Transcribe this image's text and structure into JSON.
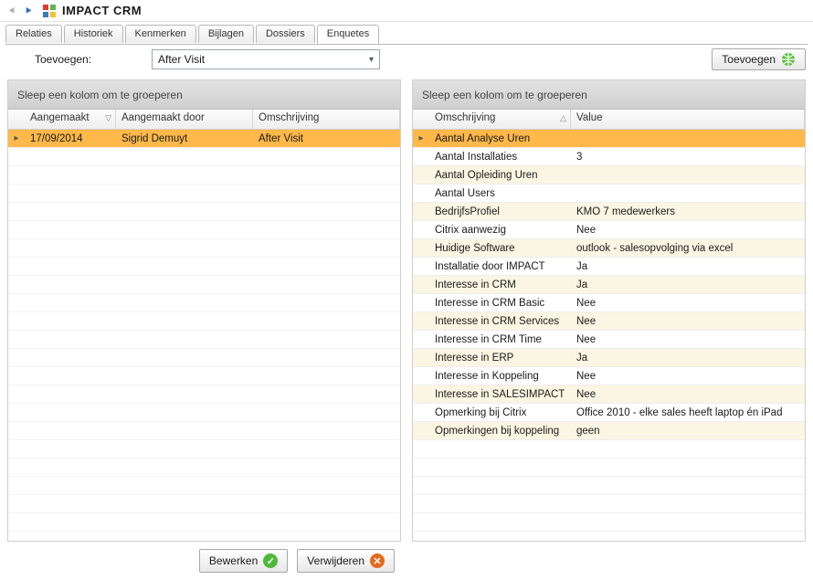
{
  "window": {
    "title": "IMPACT CRM"
  },
  "tabs": [
    {
      "label": "Relaties"
    },
    {
      "label": "Historiek"
    },
    {
      "label": "Kenmerken"
    },
    {
      "label": "Bijlagen"
    },
    {
      "label": "Dossiers"
    },
    {
      "label": "Enquetes"
    }
  ],
  "activeTabIndex": 5,
  "toolbar": {
    "add_label": "Toevoegen:",
    "dropdown_value": "After Visit",
    "add_button_label": "Toevoegen"
  },
  "leftPanel": {
    "group_hint": "Sleep een kolom om te groeperen",
    "columns": [
      {
        "label": "Aangemaakt"
      },
      {
        "label": "Aangemaakt door"
      },
      {
        "label": "Omschrijving"
      }
    ],
    "rows": [
      {
        "date": "17/09/2014",
        "by": "Sigrid Demuyt",
        "desc": "After Visit"
      }
    ]
  },
  "rightPanel": {
    "group_hint": "Sleep een kolom om te groeperen",
    "columns": [
      {
        "label": "Omschrijving"
      },
      {
        "label": "Value"
      }
    ],
    "rows": [
      {
        "k": "Aantal Analyse Uren",
        "v": ""
      },
      {
        "k": "Aantal Installaties",
        "v": "3"
      },
      {
        "k": "Aantal Opleiding Uren",
        "v": ""
      },
      {
        "k": "Aantal Users",
        "v": ""
      },
      {
        "k": "BedrijfsProfiel",
        "v": "KMO 7 medewerkers"
      },
      {
        "k": "Citrix aanwezig",
        "v": "Nee"
      },
      {
        "k": "Huidige Software",
        "v": "outlook - salesopvolging via excel"
      },
      {
        "k": "Installatie door IMPACT",
        "v": "Ja"
      },
      {
        "k": "Interesse in CRM",
        "v": "Ja"
      },
      {
        "k": "Interesse in CRM Basic",
        "v": "Nee"
      },
      {
        "k": "Interesse in CRM Services",
        "v": "Nee"
      },
      {
        "k": "Interesse in CRM Time",
        "v": "Nee"
      },
      {
        "k": "Interesse in ERP",
        "v": "Ja"
      },
      {
        "k": "Interesse in Koppeling",
        "v": "Nee"
      },
      {
        "k": "Interesse in SALESIMPACT",
        "v": "Nee"
      },
      {
        "k": "Opmerking bij Citrix",
        "v": "Office 2010 - elke sales heeft laptop én iPad"
      },
      {
        "k": "Opmerkingen bij koppeling",
        "v": "geen"
      }
    ]
  },
  "bottom": {
    "edit_label": "Bewerken",
    "delete_label": "Verwijderen"
  }
}
